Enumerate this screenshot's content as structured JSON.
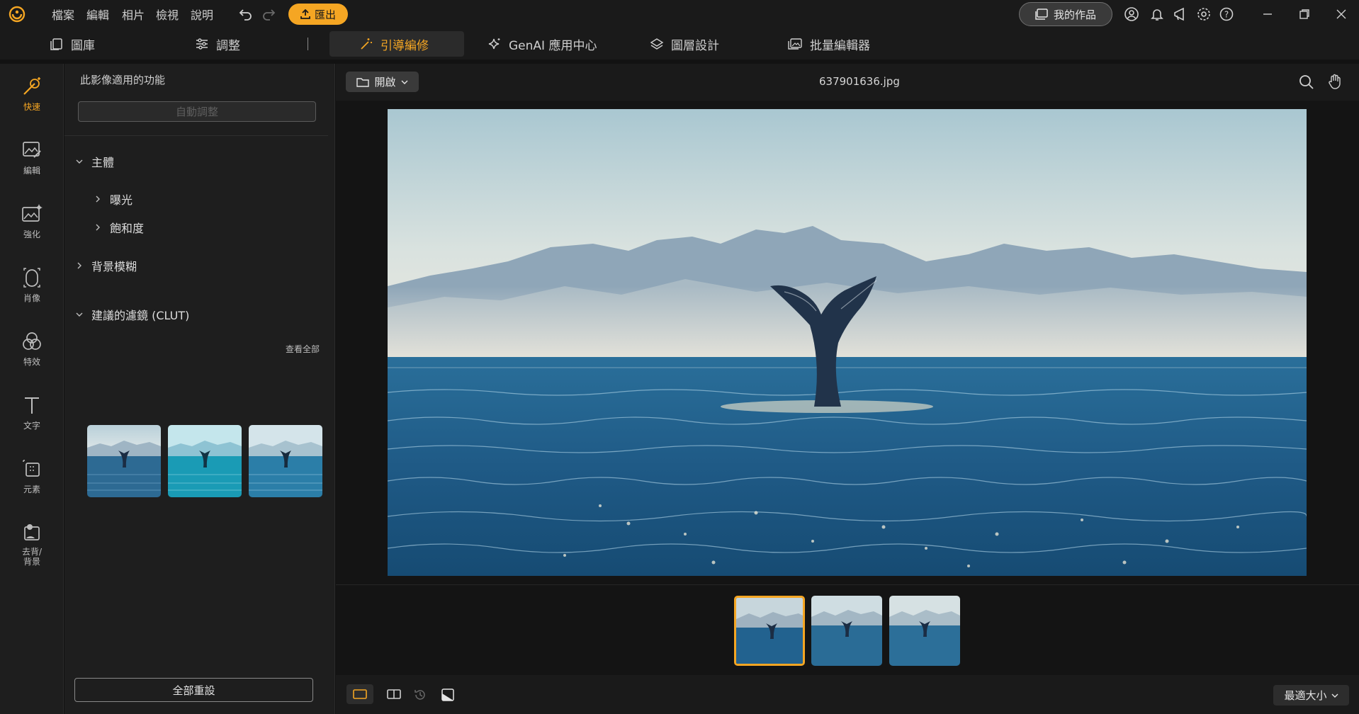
{
  "menu": [
    "檔案",
    "編輯",
    "相片",
    "檢視",
    "說明"
  ],
  "toolbar": {
    "export_label": "匯出",
    "mywork_label": "我的作品"
  },
  "tabs": [
    {
      "label": "圖庫",
      "icon": "library-icon"
    },
    {
      "label": "調整",
      "icon": "sliders-icon"
    },
    {
      "label": "引導編修",
      "icon": "magic-wand-icon"
    },
    {
      "label": "GenAI 應用中心",
      "icon": "sparkle-icon"
    },
    {
      "label": "圖層設計",
      "icon": "layers-icon"
    },
    {
      "label": "批量編輯器",
      "icon": "batch-images-icon"
    }
  ],
  "rail": [
    {
      "label": "快速"
    },
    {
      "label": "編輯"
    },
    {
      "label": "強化"
    },
    {
      "label": "肖像"
    },
    {
      "label": "特效"
    },
    {
      "label": "文字"
    },
    {
      "label": "元素"
    },
    {
      "label": "去背/\n背景"
    }
  ],
  "panel": {
    "header": "此影像適用的功能",
    "auto_adjust": "自動調整",
    "section_subject": "主體",
    "item_exposure": "曝光",
    "item_saturation": "飽和度",
    "section_bg_blur": "背景模糊",
    "section_filters": "建議的濾鏡 (CLUT)",
    "see_all": "查看全部",
    "reset_all": "全部重設"
  },
  "work": {
    "open_label": "開啟",
    "filename": "637901636.jpg",
    "zoom_label": "最適大小"
  },
  "colors": {
    "accent": "#f5a623",
    "bg": "#121212",
    "panel": "#1e1e1e"
  }
}
